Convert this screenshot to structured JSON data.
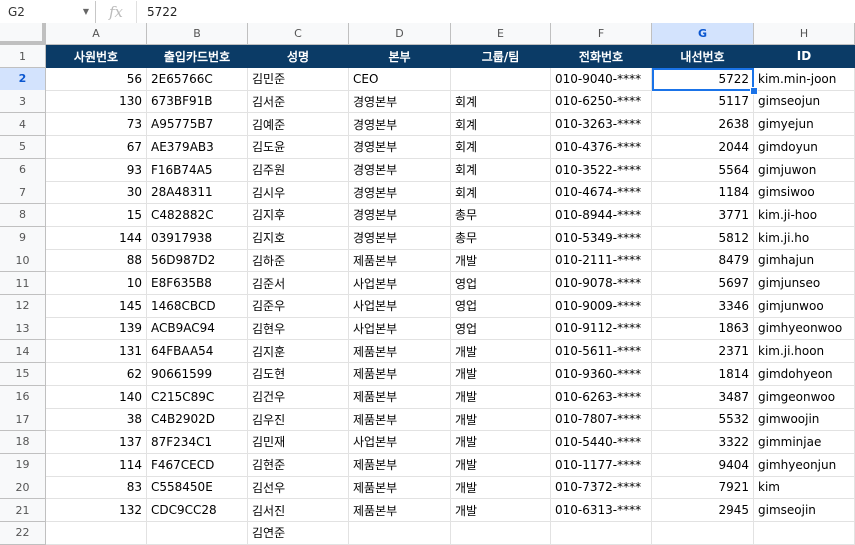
{
  "formula_bar": {
    "name_box": "G2",
    "fx_label": "fx",
    "value": "5722"
  },
  "columns": [
    "A",
    "B",
    "C",
    "D",
    "E",
    "F",
    "G",
    "H"
  ],
  "selected_column": "G",
  "selected_row": "2",
  "header_row": {
    "row_number": "1",
    "cells": [
      "사원번호",
      "출입카드번호",
      "성명",
      "본부",
      "그룹/팀",
      "전화번호",
      "내선번호",
      "ID"
    ]
  },
  "rows": [
    {
      "row_number": "2",
      "cells": [
        "56",
        "2E65766C",
        "김민준",
        "CEO",
        "",
        "010-9040-****",
        "5722",
        "kim.min-joon"
      ]
    },
    {
      "row_number": "3",
      "cells": [
        "130",
        "673BF91B",
        "김서준",
        "경영본부",
        "회계",
        "010-6250-****",
        "5117",
        "gimseojun"
      ]
    },
    {
      "row_number": "4",
      "cells": [
        "73",
        "A95775B7",
        "김예준",
        "경영본부",
        "회계",
        "010-3263-****",
        "2638",
        "gimyejun"
      ]
    },
    {
      "row_number": "5",
      "cells": [
        "67",
        "AE379AB3",
        "김도윤",
        "경영본부",
        "회계",
        "010-4376-****",
        "2044",
        "gimdoyun"
      ]
    },
    {
      "row_number": "6",
      "cells": [
        "93",
        "F16B74A5",
        "김주원",
        "경영본부",
        "회계",
        "010-3522-****",
        "5564",
        "gimjuwon"
      ]
    },
    {
      "row_number": "7",
      "cells": [
        "30",
        "28A48311",
        "김시우",
        "경영본부",
        "회계",
        "010-4674-****",
        "1184",
        "gimsiwoo"
      ]
    },
    {
      "row_number": "8",
      "cells": [
        "15",
        "C482882C",
        "김지후",
        "경영본부",
        "총무",
        "010-8944-****",
        "3771",
        "kim.ji-hoo"
      ]
    },
    {
      "row_number": "9",
      "cells": [
        "144",
        "03917938",
        "김지호",
        "경영본부",
        "총무",
        "010-5349-****",
        "5812",
        "kim.ji.ho"
      ]
    },
    {
      "row_number": "10",
      "cells": [
        "88",
        "56D987D2",
        "김하준",
        "제품본부",
        "개발",
        "010-2111-****",
        "8479",
        "gimhajun"
      ]
    },
    {
      "row_number": "11",
      "cells": [
        "10",
        "E8F635B8",
        "김준서",
        "사업본부",
        "영업",
        "010-9078-****",
        "5697",
        "gimjunseo"
      ]
    },
    {
      "row_number": "12",
      "cells": [
        "145",
        "1468CBCD",
        "김준우",
        "사업본부",
        "영업",
        "010-9009-****",
        "3346",
        "gimjunwoo"
      ]
    },
    {
      "row_number": "13",
      "cells": [
        "139",
        "ACB9AC94",
        "김현우",
        "사업본부",
        "영업",
        "010-9112-****",
        "1863",
        "gimhyeonwoo"
      ]
    },
    {
      "row_number": "14",
      "cells": [
        "131",
        "64FBAA54",
        "김지훈",
        "제품본부",
        "개발",
        "010-5611-****",
        "2371",
        "kim.ji.hoon"
      ]
    },
    {
      "row_number": "15",
      "cells": [
        "62",
        "90661599",
        "김도현",
        "제품본부",
        "개발",
        "010-9360-****",
        "1814",
        "gimdohyeon"
      ]
    },
    {
      "row_number": "16",
      "cells": [
        "140",
        "C215C89C",
        "김건우",
        "제품본부",
        "개발",
        "010-6263-****",
        "3487",
        "gimgeonwoo"
      ]
    },
    {
      "row_number": "17",
      "cells": [
        "38",
        "C4B2902D",
        "김우진",
        "제품본부",
        "개발",
        "010-7807-****",
        "5532",
        "gimwoojin"
      ]
    },
    {
      "row_number": "18",
      "cells": [
        "137",
        "87F234C1",
        "김민재",
        "사업본부",
        "개발",
        "010-5440-****",
        "3322",
        "gimminjae"
      ]
    },
    {
      "row_number": "19",
      "cells": [
        "114",
        "F467CECD",
        "김현준",
        "제품본부",
        "개발",
        "010-1177-****",
        "9404",
        "gimhyeonjun"
      ]
    },
    {
      "row_number": "20",
      "cells": [
        "83",
        "C558450E",
        "김선우",
        "제품본부",
        "개발",
        "010-7372-****",
        "7921",
        "kim"
      ]
    },
    {
      "row_number": "21",
      "cells": [
        "132",
        "CDC9CC28",
        "김서진",
        "제품본부",
        "개발",
        "010-6313-****",
        "2945",
        "gimseojin"
      ]
    },
    {
      "row_number": "22",
      "cells": [
        "",
        "",
        "김연준",
        "",
        "",
        "",
        "",
        ""
      ]
    }
  ],
  "colors": {
    "header_fill": "#0b3b66",
    "header_text": "#ffffff",
    "selection": "#1a73e8"
  }
}
